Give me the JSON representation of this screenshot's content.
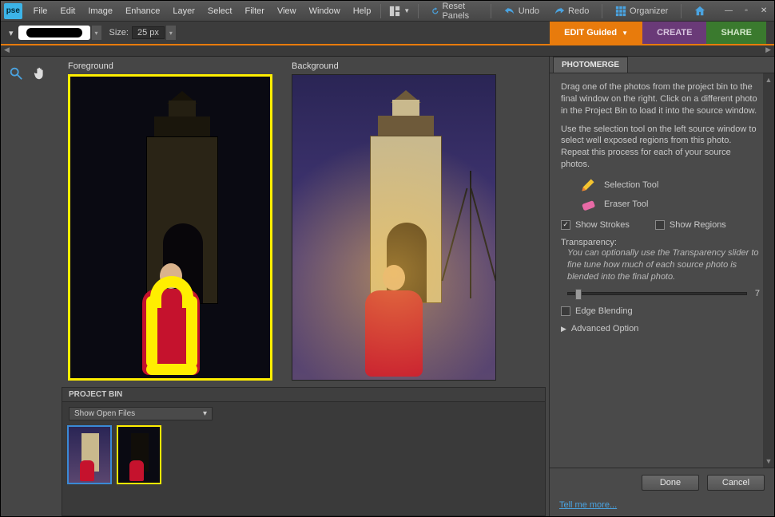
{
  "app": {
    "logo_text": "pse"
  },
  "menu": {
    "items": [
      "File",
      "Edit",
      "Image",
      "Enhance",
      "Layer",
      "Select",
      "Filter",
      "View",
      "Window",
      "Help"
    ],
    "reset_panels": "Reset Panels",
    "undo": "Undo",
    "redo": "Redo",
    "organizer": "Organizer"
  },
  "toolbar": {
    "size_label": "Size:",
    "size_value": "25 px"
  },
  "modes": {
    "edit_label": "EDIT",
    "edit_sub": "Guided",
    "create": "CREATE",
    "share": "SHARE"
  },
  "workspace": {
    "foreground_label": "Foreground",
    "background_label": "Background"
  },
  "bin": {
    "title": "PROJECT BIN",
    "dropdown": "Show Open Files"
  },
  "panel": {
    "tab": "PHOTOMERGE",
    "para1": "Drag one of the photos from the project bin to the final window on the right. Click on a different photo in the Project Bin to load it into the source window.",
    "para2": "Use the selection tool on the left source window to select well exposed regions from this photo. Repeat this process for each of your source photos.",
    "selection_tool": "Selection Tool",
    "eraser_tool": "Eraser Tool",
    "show_strokes": "Show Strokes",
    "show_regions": "Show Regions",
    "transparency_label": "Transparency:",
    "transparency_hint": "You can optionally use the Transparency slider to fine tune how much of each source photo is blended into the final photo.",
    "transparency_value": "7",
    "edge_blending": "Edge Blending",
    "advanced": "Advanced Option",
    "done": "Done",
    "cancel": "Cancel",
    "tell_more": "Tell me more..."
  }
}
